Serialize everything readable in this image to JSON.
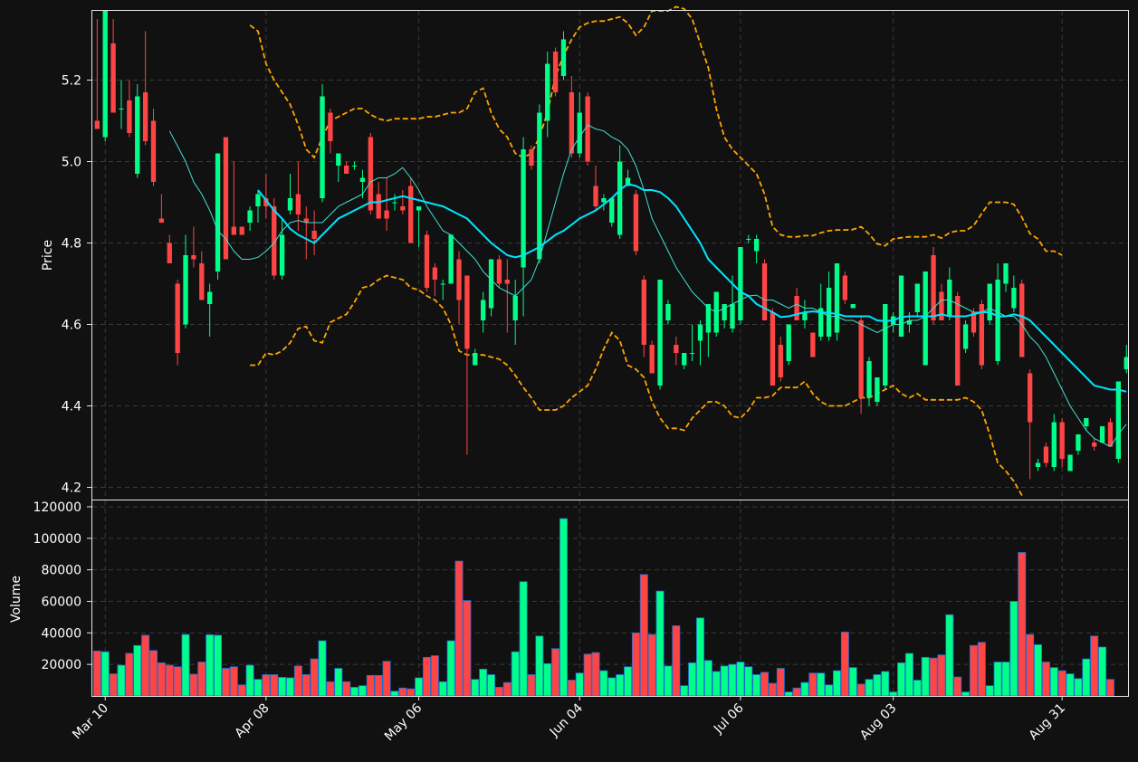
{
  "chart_data": {
    "type": "candlestick",
    "colors": {
      "background": "#111111",
      "up": "#00ff88",
      "down": "#ff4444",
      "volume_edge": "#1e6fd9",
      "bollinger": "#ffa500",
      "ma_fast": "#40e0d0",
      "ma_slow": "#00e5ff",
      "grid": "#3a3a3a"
    },
    "x_tick_labels": [
      {
        "index": 1,
        "label": "Mar 10"
      },
      {
        "index": 21,
        "label": "Apr 08"
      },
      {
        "index": 40,
        "label": "May 06"
      },
      {
        "index": 60,
        "label": "Jun 04"
      },
      {
        "index": 80,
        "label": "Jul 06"
      },
      {
        "index": 99,
        "label": "Aug 03"
      },
      {
        "index": 120,
        "label": "Aug 31"
      }
    ],
    "price_panel": {
      "ylabel": "Price",
      "ylim": [
        4.17,
        5.37
      ],
      "yticks": [
        "4.2",
        "4.4",
        "4.6",
        "4.8",
        "5.0",
        "5.2"
      ],
      "grid": true
    },
    "volume_panel": {
      "ylabel": "Volume",
      "ylim": [
        0,
        124000
      ],
      "yticks": [
        "20000",
        "40000",
        "60000",
        "80000",
        "100000",
        "120000"
      ],
      "grid": true
    },
    "ohlc": [
      [
        5.1,
        5.35,
        5.08,
        5.08
      ],
      [
        5.06,
        5.37,
        5.05,
        5.37
      ],
      [
        5.29,
        5.35,
        5.12,
        5.12
      ],
      [
        5.13,
        5.2,
        5.08,
        5.13
      ],
      [
        5.15,
        5.2,
        5.06,
        5.07
      ],
      [
        4.97,
        5.19,
        4.96,
        5.16
      ],
      [
        5.17,
        5.32,
        5.04,
        5.05
      ],
      [
        5.1,
        5.13,
        4.94,
        4.95
      ],
      [
        4.86,
        4.92,
        4.85,
        4.85
      ],
      [
        4.8,
        4.82,
        4.75,
        4.75
      ],
      [
        4.7,
        4.71,
        4.5,
        4.53
      ],
      [
        4.6,
        4.82,
        4.59,
        4.77
      ],
      [
        4.77,
        4.84,
        4.74,
        4.76
      ],
      [
        4.75,
        4.78,
        4.66,
        4.66
      ],
      [
        4.65,
        4.7,
        4.57,
        4.68
      ],
      [
        4.73,
        5.02,
        4.71,
        5.02
      ],
      [
        5.06,
        5.06,
        4.76,
        4.76
      ],
      [
        4.84,
        5.0,
        4.82,
        4.82
      ],
      [
        4.84,
        4.84,
        4.82,
        4.82
      ],
      [
        4.85,
        4.89,
        4.83,
        4.88
      ],
      [
        4.89,
        4.93,
        4.85,
        4.92
      ],
      [
        4.91,
        4.97,
        4.86,
        4.89
      ],
      [
        4.89,
        4.91,
        4.71,
        4.72
      ],
      [
        4.72,
        4.86,
        4.71,
        4.82
      ],
      [
        4.88,
        4.97,
        4.87,
        4.91
      ],
      [
        4.92,
        5.0,
        4.83,
        4.87
      ],
      [
        4.86,
        4.89,
        4.76,
        4.85
      ],
      [
        4.83,
        4.88,
        4.77,
        4.81
      ],
      [
        4.91,
        5.19,
        4.9,
        5.16
      ],
      [
        5.12,
        5.13,
        5.02,
        5.05
      ],
      [
        4.99,
        5.02,
        4.95,
        5.02
      ],
      [
        4.99,
        5.0,
        4.97,
        4.97
      ],
      [
        4.99,
        5.0,
        4.98,
        4.99
      ],
      [
        4.95,
        4.98,
        4.91,
        4.96
      ],
      [
        5.06,
        5.07,
        4.87,
        4.88
      ],
      [
        4.92,
        4.95,
        4.86,
        4.86
      ],
      [
        4.88,
        4.96,
        4.83,
        4.86
      ],
      [
        4.9,
        4.92,
        4.88,
        4.9
      ],
      [
        4.89,
        4.93,
        4.87,
        4.88
      ],
      [
        4.94,
        4.96,
        4.8,
        4.8
      ],
      [
        4.88,
        4.88,
        4.79,
        4.89
      ],
      [
        4.82,
        4.83,
        4.68,
        4.69
      ],
      [
        4.74,
        4.75,
        4.67,
        4.71
      ],
      [
        4.7,
        4.71,
        4.66,
        4.7
      ],
      [
        4.7,
        4.82,
        4.7,
        4.82
      ],
      [
        4.76,
        4.78,
        4.6,
        4.66
      ],
      [
        4.72,
        4.72,
        4.28,
        4.54
      ],
      [
        4.5,
        4.54,
        4.5,
        4.53
      ],
      [
        4.61,
        4.68,
        4.58,
        4.66
      ],
      [
        4.64,
        4.76,
        4.62,
        4.76
      ],
      [
        4.76,
        4.77,
        4.69,
        4.7
      ],
      [
        4.71,
        4.76,
        4.58,
        4.7
      ],
      [
        4.61,
        4.71,
        4.55,
        4.67
      ],
      [
        4.74,
        5.06,
        4.62,
        5.03
      ],
      [
        5.03,
        5.04,
        4.98,
        4.99
      ],
      [
        4.76,
        5.14,
        4.75,
        5.12
      ],
      [
        5.1,
        5.27,
        5.06,
        5.24
      ],
      [
        5.27,
        5.28,
        5.16,
        5.17
      ],
      [
        5.21,
        5.32,
        5.2,
        5.3
      ],
      [
        5.17,
        5.21,
        5.01,
        5.02
      ],
      [
        5.02,
        5.17,
        5.01,
        5.12
      ],
      [
        5.16,
        5.17,
        4.99,
        5.0
      ],
      [
        4.94,
        4.99,
        4.88,
        4.89
      ],
      [
        4.9,
        4.92,
        4.88,
        4.91
      ],
      [
        4.85,
        4.91,
        4.84,
        4.91
      ],
      [
        4.82,
        5.04,
        4.81,
        5.0
      ],
      [
        4.94,
        4.98,
        4.94,
        4.96
      ],
      [
        4.92,
        4.93,
        4.77,
        4.78
      ],
      [
        4.71,
        4.72,
        4.52,
        4.55
      ],
      [
        4.55,
        4.56,
        4.48,
        4.48
      ],
      [
        4.45,
        4.71,
        4.44,
        4.71
      ],
      [
        4.61,
        4.66,
        4.6,
        4.65
      ],
      [
        4.55,
        4.57,
        4.5,
        4.53
      ],
      [
        4.5,
        4.53,
        4.49,
        4.53
      ],
      [
        4.53,
        4.6,
        4.51,
        4.53
      ],
      [
        4.56,
        4.61,
        4.5,
        4.6
      ],
      [
        4.58,
        4.65,
        4.52,
        4.65
      ],
      [
        4.58,
        4.68,
        4.57,
        4.68
      ],
      [
        4.61,
        4.65,
        4.59,
        4.65
      ],
      [
        4.59,
        4.72,
        4.58,
        4.65
      ],
      [
        4.61,
        4.79,
        4.6,
        4.79
      ],
      [
        4.81,
        4.82,
        4.8,
        4.81
      ],
      [
        4.78,
        4.82,
        4.75,
        4.81
      ],
      [
        4.75,
        4.76,
        4.61,
        4.61
      ],
      [
        4.63,
        4.64,
        4.45,
        4.45
      ],
      [
        4.55,
        4.57,
        4.46,
        4.47
      ],
      [
        4.51,
        4.6,
        4.5,
        4.6
      ],
      [
        4.67,
        4.69,
        4.61,
        4.61
      ],
      [
        4.61,
        4.66,
        4.59,
        4.63
      ],
      [
        4.58,
        4.58,
        4.52,
        4.52
      ],
      [
        4.57,
        4.7,
        4.56,
        4.64
      ],
      [
        4.57,
        4.73,
        4.56,
        4.69
      ],
      [
        4.58,
        4.75,
        4.56,
        4.75
      ],
      [
        4.72,
        4.73,
        4.65,
        4.66
      ],
      [
        4.64,
        4.65,
        4.64,
        4.65
      ],
      [
        4.61,
        4.62,
        4.38,
        4.42
      ],
      [
        4.42,
        4.52,
        4.4,
        4.51
      ],
      [
        4.41,
        4.47,
        4.4,
        4.47
      ],
      [
        4.45,
        4.65,
        4.44,
        4.65
      ],
      [
        4.6,
        4.63,
        4.58,
        4.62
      ],
      [
        4.57,
        4.72,
        4.57,
        4.72
      ],
      [
        4.6,
        4.63,
        4.58,
        4.61
      ],
      [
        4.63,
        4.7,
        4.62,
        4.7
      ],
      [
        4.5,
        4.73,
        4.5,
        4.73
      ],
      [
        4.77,
        4.79,
        4.6,
        4.61
      ],
      [
        4.68,
        4.7,
        4.61,
        4.61
      ],
      [
        4.62,
        4.74,
        4.61,
        4.71
      ],
      [
        4.67,
        4.68,
        4.45,
        4.45
      ],
      [
        4.54,
        4.61,
        4.53,
        4.6
      ],
      [
        4.63,
        4.64,
        4.57,
        4.58
      ],
      [
        4.65,
        4.66,
        4.49,
        4.5
      ],
      [
        4.61,
        4.7,
        4.6,
        4.7
      ],
      [
        4.51,
        4.75,
        4.5,
        4.71
      ],
      [
        4.7,
        4.75,
        4.68,
        4.75
      ],
      [
        4.64,
        4.72,
        4.63,
        4.69
      ],
      [
        4.7,
        4.71,
        4.52,
        4.52
      ],
      [
        4.48,
        4.49,
        4.22,
        4.36
      ],
      [
        4.25,
        4.27,
        4.24,
        4.26
      ],
      [
        4.3,
        4.31,
        4.25,
        4.26
      ],
      [
        4.25,
        4.38,
        4.24,
        4.36
      ],
      [
        4.36,
        4.37,
        4.25,
        4.27
      ],
      [
        4.24,
        4.28,
        4.24,
        4.28
      ],
      [
        4.29,
        4.33,
        4.28,
        4.33
      ],
      [
        4.35,
        4.37,
        4.34,
        4.37
      ],
      [
        4.31,
        4.32,
        4.29,
        4.3
      ],
      [
        4.31,
        4.35,
        4.31,
        4.35
      ],
      [
        4.36,
        4.37,
        4.3,
        4.3
      ],
      [
        4.27,
        4.46,
        4.26,
        4.46
      ],
      [
        4.49,
        4.55,
        4.48,
        4.52
      ]
    ],
    "volume": [
      28500,
      28000,
      14000,
      19500,
      27000,
      32000,
      38500,
      28800,
      21000,
      19500,
      18500,
      39000,
      13800,
      21500,
      38800,
      38500,
      17500,
      18500,
      7000,
      19500,
      10500,
      13500,
      13500,
      11800,
      11500,
      19000,
      13500,
      23500,
      35000,
      9000,
      17500,
      9000,
      5500,
      6500,
      13000,
      13000,
      22000,
      3000,
      5000,
      4500,
      11500,
      24500,
      25500,
      9000,
      35000,
      85500,
      60500,
      10500,
      17000,
      13500,
      5500,
      8500,
      28000,
      72500,
      13500,
      38000,
      20500,
      30000,
      112500,
      10000,
      14500,
      26500,
      27500,
      16000,
      11500,
      13500,
      18500,
      40000,
      77000,
      39000,
      66500,
      19000,
      44500,
      6500,
      21000,
      49500,
      22500,
      15500,
      19000,
      20000,
      21500,
      18500,
      13500,
      15000,
      8000,
      17500,
      2500,
      5000,
      8500,
      14500,
      14500,
      7000,
      16000,
      40500,
      18000,
      7500,
      10500,
      13500,
      15500,
      2500,
      21000,
      27000,
      10000,
      24500,
      24000,
      26000,
      51500,
      12000,
      2500,
      32000,
      34000,
      6500,
      21500,
      21500,
      60000,
      91000,
      39000,
      32500,
      21500,
      18000,
      16000,
      14000,
      11000,
      23500,
      38000,
      31000,
      10500
    ],
    "ma_fast": [
      null,
      null,
      null,
      null,
      null,
      null,
      null,
      null,
      null,
      5.075,
      5.038,
      5.0,
      4.95,
      4.92,
      4.88,
      4.83,
      4.81,
      4.78,
      4.76,
      4.76,
      4.765,
      4.78,
      4.8,
      4.83,
      4.85,
      4.855,
      4.85,
      4.85,
      4.85,
      4.87,
      4.89,
      4.9,
      4.91,
      4.92,
      4.95,
      4.96,
      4.96,
      4.97,
      4.985,
      4.96,
      4.93,
      4.89,
      4.86,
      4.83,
      4.82,
      4.8,
      4.78,
      4.76,
      4.73,
      4.71,
      4.69,
      4.68,
      4.67,
      4.69,
      4.71,
      4.76,
      4.83,
      4.9,
      4.97,
      5.03,
      5.06,
      5.09,
      5.08,
      5.075,
      5.06,
      5.05,
      5.03,
      4.99,
      4.93,
      4.86,
      4.82,
      4.78,
      4.74,
      4.71,
      4.68,
      4.66,
      4.64,
      4.63,
      4.64,
      4.65,
      4.66,
      4.67,
      4.672,
      4.66,
      4.66,
      4.65,
      4.64,
      4.65,
      4.64,
      4.64,
      4.63,
      4.62,
      4.62,
      4.61,
      4.61,
      4.6,
      4.59,
      4.58,
      4.59,
      4.6,
      4.6,
      4.61,
      4.61,
      4.62,
      4.64,
      4.66,
      4.66,
      4.65,
      4.64,
      4.63,
      4.63,
      4.64,
      4.63,
      4.62,
      4.62,
      4.6,
      4.57,
      4.55,
      4.52,
      4.48,
      4.44,
      4.4,
      4.37,
      4.34,
      4.32,
      4.31,
      4.3,
      4.33,
      4.355
    ],
    "ma_slow": [
      null,
      null,
      null,
      null,
      null,
      null,
      null,
      null,
      null,
      null,
      null,
      null,
      null,
      null,
      null,
      null,
      null,
      null,
      null,
      null,
      4.93,
      4.905,
      4.88,
      4.86,
      4.835,
      4.82,
      4.81,
      4.8,
      4.82,
      4.84,
      4.86,
      4.87,
      4.88,
      4.89,
      4.9,
      4.9,
      4.905,
      4.91,
      4.915,
      4.91,
      4.905,
      4.9,
      4.895,
      4.89,
      4.88,
      4.87,
      4.86,
      4.84,
      4.82,
      4.8,
      4.785,
      4.77,
      4.765,
      4.77,
      4.78,
      4.79,
      4.805,
      4.82,
      4.83,
      4.845,
      4.86,
      4.87,
      4.88,
      4.895,
      4.91,
      4.93,
      4.945,
      4.94,
      4.93,
      4.93,
      4.925,
      4.91,
      4.89,
      4.86,
      4.83,
      4.8,
      4.76,
      4.74,
      4.72,
      4.7,
      4.68,
      4.67,
      4.65,
      4.64,
      4.63,
      4.618,
      4.62,
      4.625,
      4.63,
      4.632,
      4.63,
      4.628,
      4.626,
      4.62,
      4.62,
      4.62,
      4.62,
      4.61,
      4.608,
      4.61,
      4.618,
      4.62,
      4.62,
      4.62,
      4.62,
      4.625,
      4.62,
      4.62,
      4.62,
      4.625,
      4.63,
      4.63,
      4.62,
      4.62,
      4.625,
      4.62,
      4.61,
      4.59,
      4.57,
      4.55,
      4.53,
      4.51,
      4.49,
      4.47,
      4.45,
      4.445,
      4.44,
      4.44,
      4.435
    ],
    "bb_upper": [
      null,
      null,
      null,
      null,
      null,
      null,
      null,
      null,
      null,
      null,
      null,
      null,
      null,
      null,
      null,
      null,
      null,
      null,
      null,
      5.335,
      5.32,
      5.24,
      5.2,
      5.17,
      5.14,
      5.09,
      5.03,
      5.01,
      5.06,
      5.1,
      5.11,
      5.12,
      5.13,
      5.13,
      5.115,
      5.105,
      5.1,
      5.105,
      5.105,
      5.105,
      5.105,
      5.11,
      5.11,
      5.115,
      5.12,
      5.12,
      5.13,
      5.17,
      5.18,
      5.12,
      5.08,
      5.06,
      5.02,
      5.01,
      5.02,
      5.06,
      5.12,
      5.21,
      5.26,
      5.3,
      5.33,
      5.34,
      5.345,
      5.345,
      5.35,
      5.355,
      5.34,
      5.31,
      5.33,
      5.37,
      5.37,
      5.37,
      5.38,
      5.375,
      5.35,
      5.29,
      5.23,
      5.13,
      5.06,
      5.03,
      5.01,
      4.99,
      4.97,
      4.92,
      4.84,
      4.82,
      4.815,
      4.815,
      4.818,
      4.818,
      4.825,
      4.83,
      4.832,
      4.832,
      4.833,
      4.84,
      4.822,
      4.798,
      4.793,
      4.81,
      4.813,
      4.815,
      4.815,
      4.815,
      4.82,
      4.812,
      4.825,
      4.83,
      4.83,
      4.843,
      4.872,
      4.9,
      4.9,
      4.9,
      4.895,
      4.863,
      4.823,
      4.81,
      4.78,
      4.78,
      4.77
    ],
    "bb_lower": [
      null,
      null,
      null,
      null,
      null,
      null,
      null,
      null,
      null,
      null,
      null,
      null,
      null,
      null,
      null,
      null,
      null,
      null,
      null,
      4.5,
      4.5,
      4.53,
      4.525,
      4.535,
      4.555,
      4.59,
      4.595,
      4.56,
      4.555,
      4.605,
      4.615,
      4.625,
      4.655,
      4.69,
      4.695,
      4.71,
      4.72,
      4.715,
      4.71,
      4.69,
      4.685,
      4.67,
      4.66,
      4.64,
      4.6,
      4.535,
      4.525,
      4.525,
      4.525,
      4.52,
      4.515,
      4.5,
      4.475,
      4.445,
      4.42,
      4.39,
      4.39,
      4.39,
      4.4,
      4.42,
      4.435,
      4.45,
      4.49,
      4.54,
      4.58,
      4.56,
      4.5,
      4.49,
      4.47,
      4.41,
      4.37,
      4.345,
      4.345,
      4.34,
      4.37,
      4.39,
      4.41,
      4.41,
      4.4,
      4.375,
      4.37,
      4.39,
      4.42,
      4.42,
      4.425,
      4.445,
      4.445,
      4.445,
      4.46,
      4.43,
      4.41,
      4.4,
      4.4,
      4.4,
      4.41,
      4.42,
      4.42,
      4.43,
      4.44,
      4.45,
      4.43,
      4.42,
      4.43,
      4.415,
      4.415,
      4.415,
      4.415,
      4.415,
      4.42,
      4.41,
      4.39,
      4.33,
      4.26,
      4.24,
      4.215,
      4.18
    ]
  }
}
